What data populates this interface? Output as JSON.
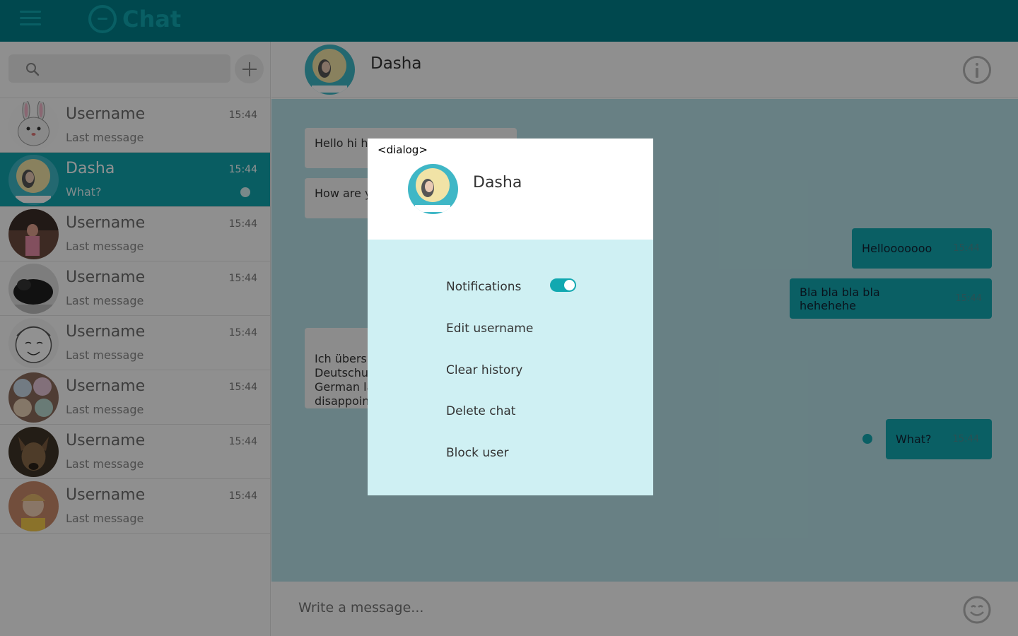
{
  "app": {
    "title": "Chat"
  },
  "sidebar": {
    "search": {
      "placeholder": ""
    },
    "chats": [
      {
        "name": "Username",
        "last": "Last message",
        "time": "15:44"
      },
      {
        "name": "Dasha",
        "last": "What?",
        "time": "15:44"
      },
      {
        "name": "Username",
        "last": "Last message",
        "time": "15:44"
      },
      {
        "name": "Username",
        "last": "Last message",
        "time": "15:44"
      },
      {
        "name": "Username",
        "last": "Last message",
        "time": "15:44"
      },
      {
        "name": "Username",
        "last": "Last message",
        "time": "15:44"
      },
      {
        "name": "Username",
        "last": "Last message",
        "time": "15:44"
      },
      {
        "name": "Username",
        "last": "Last message",
        "time": "15:44"
      }
    ]
  },
  "conversation": {
    "name": "Dasha",
    "incoming": [
      "Hello hi h",
      "How are y",
      "Ich übersp\nDeutschu\nGerman la\ndisappoin"
    ],
    "outgoing": [
      {
        "text": "Hellooooooo",
        "time": "15:44"
      },
      {
        "text": "Bla bla bla bla hehehehe",
        "time": "15:44"
      },
      {
        "text": "What?",
        "time": "15:44"
      }
    ]
  },
  "composer": {
    "placeholder": "Write a message..."
  },
  "dialog": {
    "tag": "<dialog>",
    "name": "Dasha",
    "options": {
      "notifications": "Notifications",
      "edit_username": "Edit username",
      "clear_history": "Clear history",
      "delete_chat": "Delete chat",
      "block_user": "Block user"
    },
    "notifications_on": true
  },
  "colors": {
    "topbar": "#007f8a",
    "accent": "#11a4ad",
    "messages_bg": "#b7e2e9",
    "dialog_body": "#cff0f3"
  },
  "icons": [
    "menu-icon",
    "chat-logo-icon",
    "search-icon",
    "plus-icon",
    "info-icon",
    "smiley-icon"
  ]
}
